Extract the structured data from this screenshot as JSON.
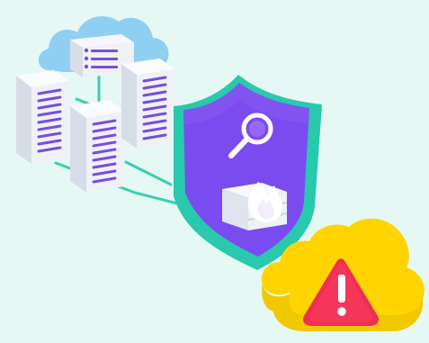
{
  "scene": {
    "description_free": true,
    "colors": {
      "background": "#e6f8f4",
      "cloud_blue": "#8fd0f2",
      "server_white": "#f2f4f8",
      "server_stripe": "#7a4ce0",
      "connector": "#37d0b3",
      "shield_outer": "#2fd3b6",
      "shield_inner": "#7a4cf0",
      "alert_cloud": "#ffd400",
      "alert_triangle": "#ef2f54"
    },
    "icons": [
      "cloud-server-icon",
      "server-tower-icon",
      "shield-icon",
      "magnifier-icon",
      "firewall-icon",
      "fire-icon",
      "warning-cloud-icon",
      "warning-triangle-icon"
    ]
  }
}
